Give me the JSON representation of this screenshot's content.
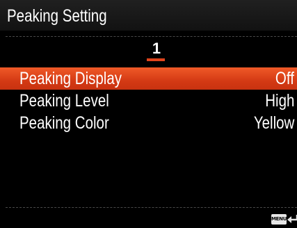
{
  "header": {
    "title": "Peaking Setting"
  },
  "page": {
    "number": "1"
  },
  "menu": {
    "items": [
      {
        "label": "Peaking Display",
        "value": "Off",
        "selected": true
      },
      {
        "label": "Peaking Level",
        "value": "High",
        "selected": false
      },
      {
        "label": "Peaking Color",
        "value": "Yellow",
        "selected": false
      }
    ]
  },
  "footer": {
    "menu_key": "MENU",
    "back_icon": "return-arrow-icon"
  },
  "colors": {
    "highlight": "#e04a1e",
    "background": "#000000",
    "text": "#ffffff"
  }
}
